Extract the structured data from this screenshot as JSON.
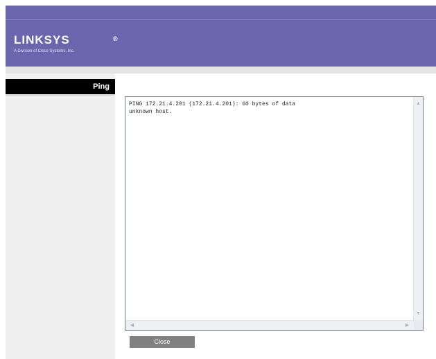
{
  "header": {
    "logo_text": "LINKSYS",
    "logo_mark": "®",
    "logo_subtitle": "A Division of Cisco Systems, Inc."
  },
  "sidebar": {
    "title": "Ping"
  },
  "output": {
    "text": "PING 172.21.4.201 (172.21.4.201): 60 bytes of data\nunknown host."
  },
  "actions": {
    "close_label": "Close"
  },
  "icons": {
    "scroll_up": "▲",
    "scroll_down": "▼",
    "scroll_left": "◀",
    "scroll_right": "▶"
  },
  "colors": {
    "header": "#6a65ad",
    "sidebar_title_bg": "#000000",
    "sidebar_bg": "#efefef",
    "button_bg": "#808080"
  }
}
